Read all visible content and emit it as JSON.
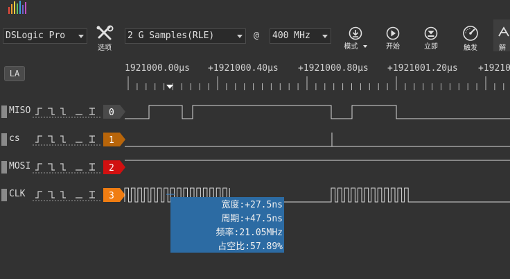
{
  "device": {
    "name": "DSLogic Pro"
  },
  "options_button": {
    "label": "选项"
  },
  "samples": {
    "value": "2 G Samples(RLE)"
  },
  "at_symbol": "@",
  "frequency": {
    "value": "400 MHz"
  },
  "toolbar": [
    {
      "label": "模式",
      "icon": "download-icon"
    },
    {
      "label": "开始",
      "icon": "play-icon"
    },
    {
      "label": "立即",
      "icon": "instant-icon"
    },
    {
      "label": "触发",
      "icon": "gauge-icon"
    },
    {
      "label": "解",
      "icon": "decode-icon"
    }
  ],
  "la_button": "LA",
  "ruler": {
    "labels": [
      "1921000.00μs",
      "+1921000.40μs",
      "+1921000.80μs",
      "+1921001.20μs",
      "+19210"
    ]
  },
  "channels": [
    {
      "name": "MISO",
      "index": "0",
      "color": "#4a4a4a"
    },
    {
      "name": "cs",
      "index": "1",
      "color": "#b8650a"
    },
    {
      "name": "MOSI",
      "index": "2",
      "color": "#d11010"
    },
    {
      "name": "CLK",
      "index": "3",
      "color": "#f07d12"
    }
  ],
  "measure_tooltip": {
    "width": "宽度:+27.5ns",
    "period": "周期:+47.5ns",
    "freq": "频率:21.05MHz",
    "duty": "占空比:57.89%"
  },
  "colors": {
    "background": "#323232",
    "signal": "#d8d8d8",
    "tooltip": "#2c6ba3"
  }
}
